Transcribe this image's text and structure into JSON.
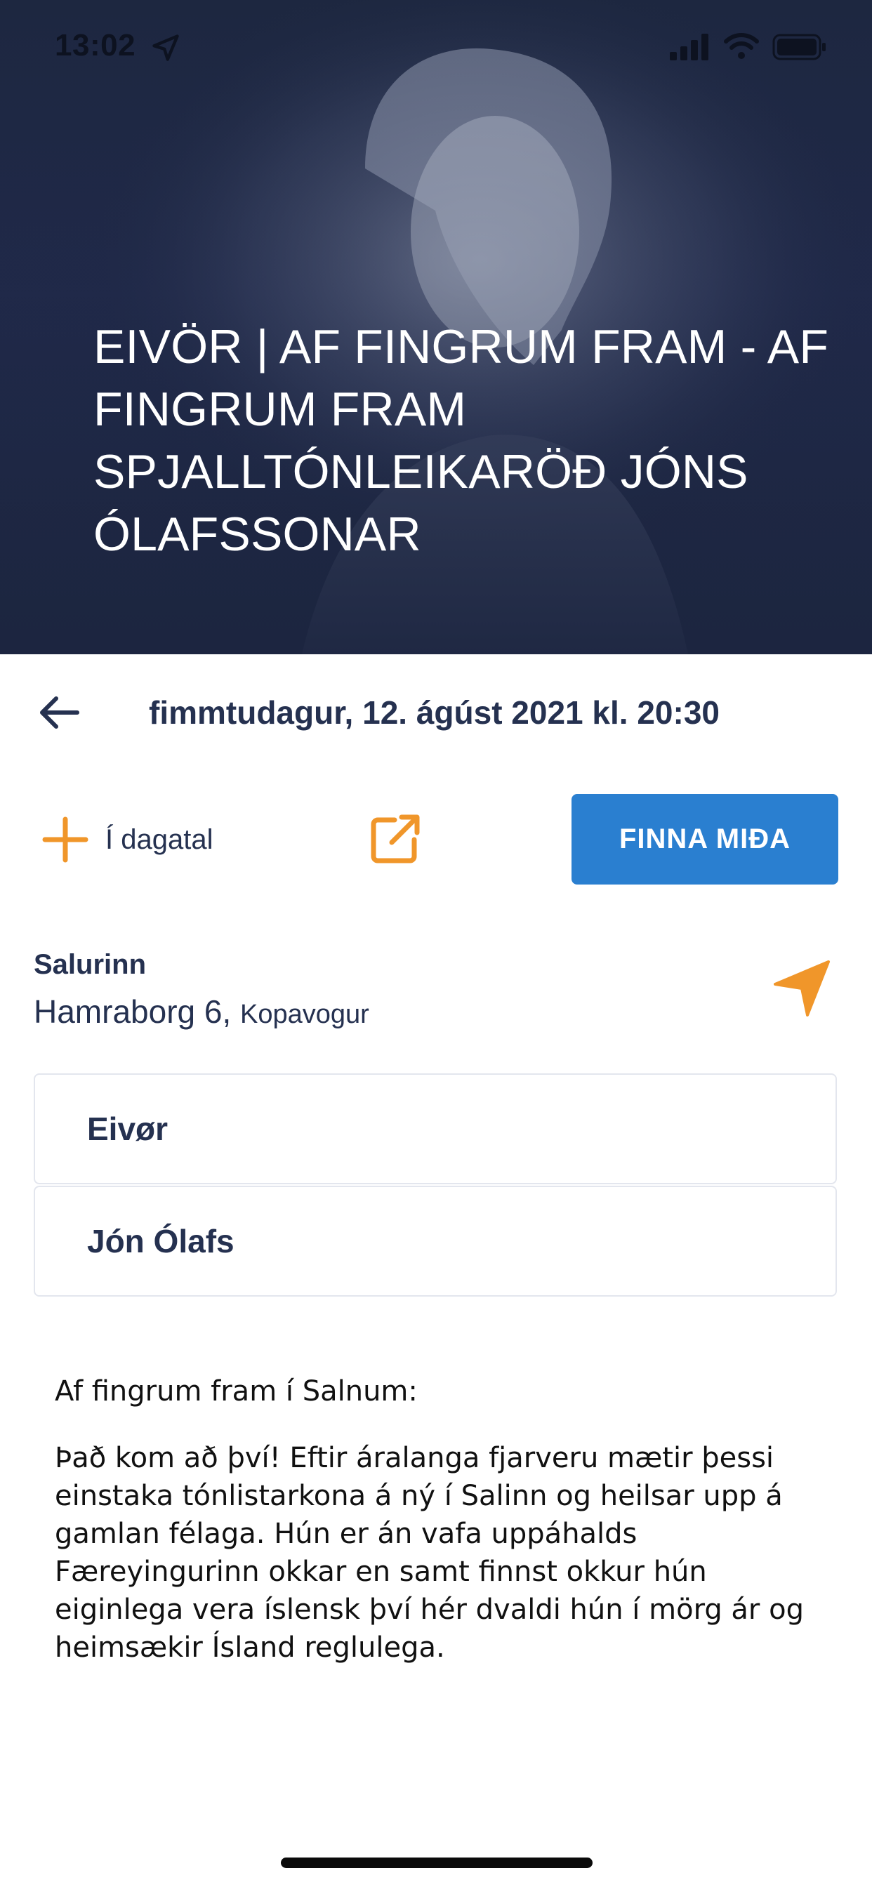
{
  "status_bar": {
    "time": "13:02"
  },
  "event": {
    "title": "EIVÖR | AF FINGRUM FRAM - AF FINGRUM FRAM SPJALLTÓNLEIKARÖÐ JÓNS ÓLAFSSONAR",
    "date": "fimmtudagur, 12. ágúst 2021 kl. 20:30"
  },
  "actions": {
    "add_calendar_label": "Í dagatal",
    "ticket_button_label": "FINNA MIÐA"
  },
  "venue": {
    "name": "Salurinn",
    "street": "Hamraborg 6,",
    "city": "Kopavogur"
  },
  "performers": [
    {
      "name": "Eivør"
    },
    {
      "name": "Jón Ólafs"
    }
  ],
  "description": {
    "heading": "Af fingrum fram í Salnum:",
    "body": "Það kom að því!  Eftir áralanga fjarveru mætir þessi einstaka tónlistarkona á ný í Salinn og heilsar upp á gamlan félaga. Hún er án vafa uppáhalds Færeyingurinn okkar en samt finnst okkur hún eiginlega vera íslensk því hér dvaldi hún í mörg ár og heimsækir Ísland reglulega."
  },
  "colors": {
    "accent_orange": "#f0962a",
    "primary_blue": "#2a7fd0",
    "text_navy": "#253150",
    "hero_bg": "#1d2740"
  },
  "icons": {
    "back": "arrow-left-icon",
    "add_calendar": "plus-icon",
    "share": "external-link-icon",
    "navigate": "location-arrow-icon"
  }
}
